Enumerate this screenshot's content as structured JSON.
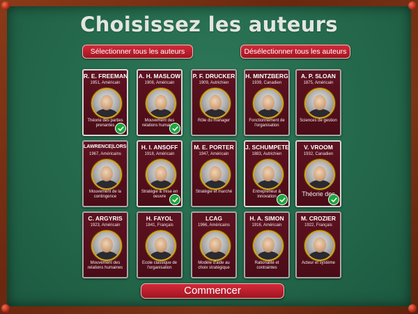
{
  "title": "Choisissez les auteurs",
  "buttons": {
    "select_all": "Sélectionner tous les auteurs",
    "deselect_all": "Désélectionner tous les auteurs",
    "start": "Commencer"
  },
  "authors": [
    {
      "name": "R. E. FREEMAN",
      "meta": "1951, Américain",
      "desc": "Théorie des parties prenantes",
      "selected": true
    },
    {
      "name": "A. H. MASLOW",
      "meta": "1908, Américain",
      "desc": "Mouvement des relations humaines",
      "selected": true
    },
    {
      "name": "P. F. DRUCKER",
      "meta": "1909, Autrichien",
      "desc": "Rôle du manager",
      "selected": false
    },
    {
      "name": "H. MINTZBERG",
      "meta": "1939, Canadien",
      "desc": "Fonctionnement de l'organisation",
      "selected": false
    },
    {
      "name": "A. P. SLOAN",
      "meta": "1875, Américain",
      "desc": "Sciences de gestion",
      "selected": false
    },
    {
      "name": "LAWRENCE|LORSCH",
      "meta": "1967, Américains",
      "desc": "Mouvement de la contingence",
      "selected": false
    },
    {
      "name": "H. I. ANSOFF",
      "meta": "1918, Américain",
      "desc": "Stratégie & mise en oeuvre",
      "selected": true
    },
    {
      "name": "M. E. PORTER",
      "meta": "1947, Américain",
      "desc": "Stratégie et marché",
      "selected": false
    },
    {
      "name": "J. SCHUMPETER",
      "meta": "1883, Autrichien",
      "desc": "Entrepreneur & innovation",
      "selected": true
    },
    {
      "name": "V. VROOM",
      "meta": "1932, Canadien",
      "desc": "Théorie des",
      "selected": true
    },
    {
      "name": "C. ARGYRIS",
      "meta": "1923, Américain",
      "desc": "Mouvement des relations humaines",
      "selected": false
    },
    {
      "name": "H. FAYOL",
      "meta": "1841, Français",
      "desc": "Ecole classique de l'organisation",
      "selected": false
    },
    {
      "name": "LCAG",
      "meta": "1966, Américains",
      "desc": "Modèle d'aide au choix stratégique",
      "selected": false
    },
    {
      "name": "H. A. SIMON",
      "meta": "1916, Américain",
      "desc": "Rationalité et contraintes",
      "selected": false
    },
    {
      "name": "M. CROZIER",
      "meta": "1922, Français",
      "desc": "Acteur et système",
      "selected": false
    }
  ]
}
